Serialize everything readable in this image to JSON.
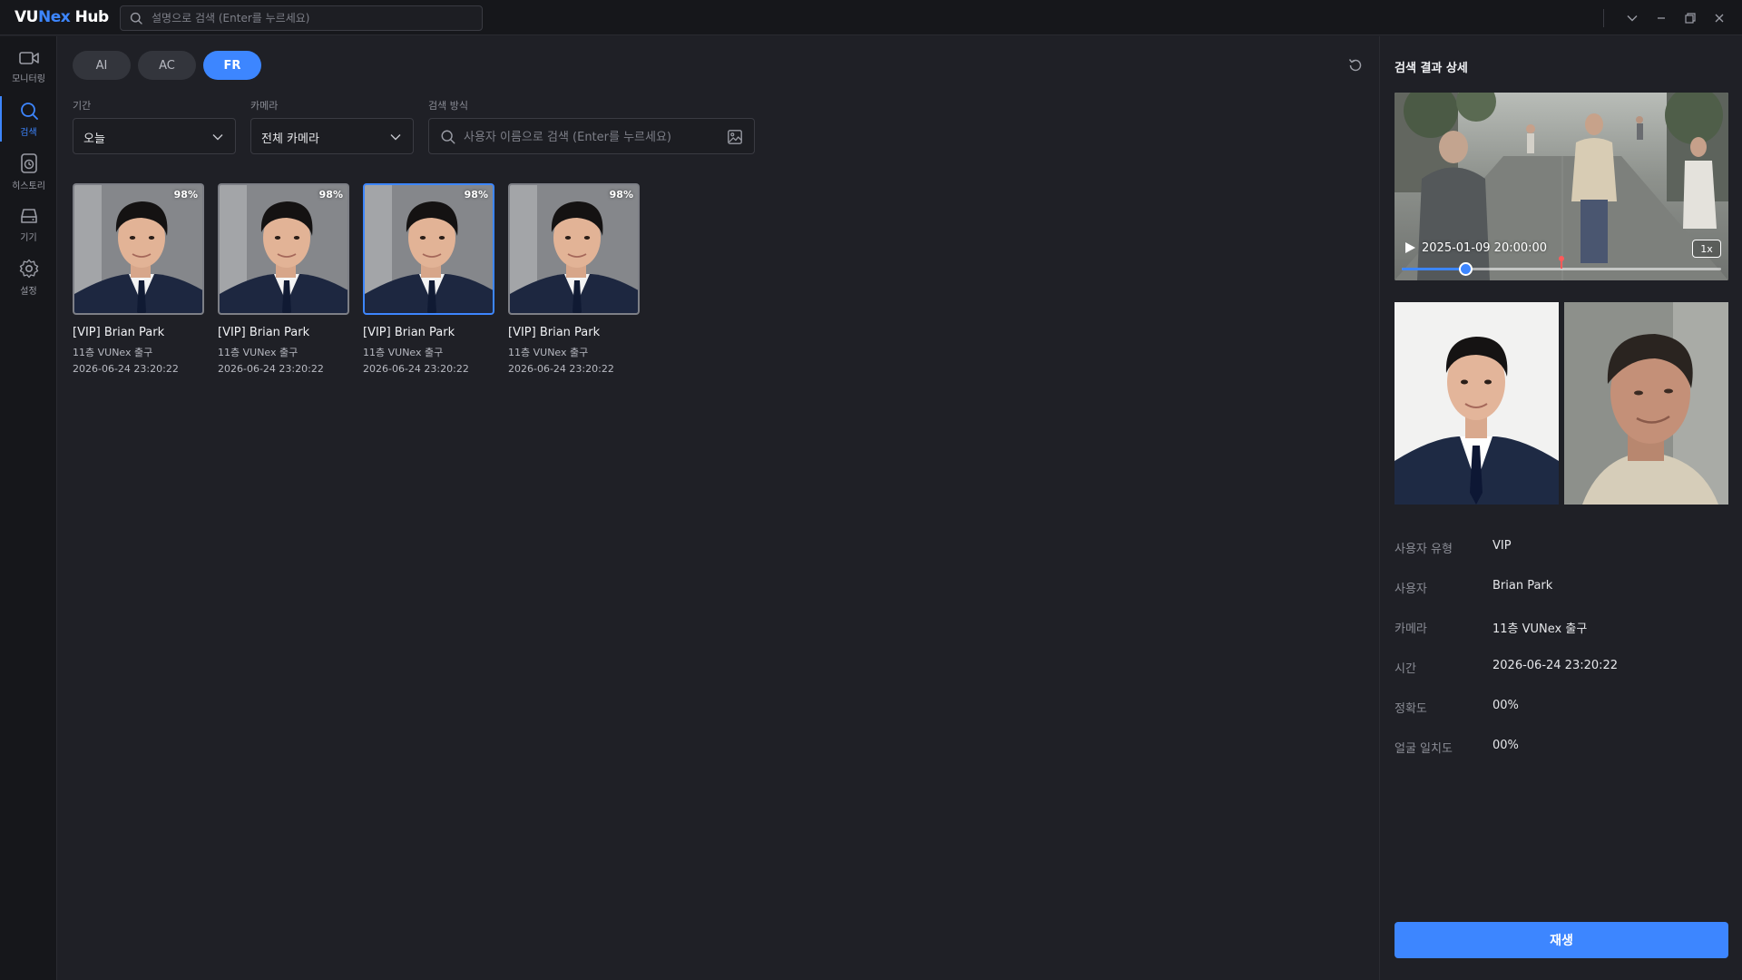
{
  "app": {
    "logo_prefix": "VU",
    "logo_mid": "Nex",
    "logo_suffix": " Hub",
    "search_placeholder": "설명으로 검색 (Enter를 누르세요)"
  },
  "rail": [
    {
      "label": "모니터링",
      "icon": "video-camera-icon"
    },
    {
      "label": "검색",
      "icon": "search-icon"
    },
    {
      "label": "히스토리",
      "icon": "history-icon"
    },
    {
      "label": "기기",
      "icon": "device-icon"
    },
    {
      "label": "설정",
      "icon": "gear-icon"
    }
  ],
  "tabs": [
    "AI",
    "AC",
    "FR"
  ],
  "active_tab": "FR",
  "filters": {
    "period_label": "기간",
    "period_value": "오늘",
    "camera_label": "카메라",
    "camera_value": "전체 카메라",
    "method_label": "검색 방식",
    "method_placeholder": "사용자 이름으로 검색 (Enter를 누르세요)"
  },
  "results": [
    {
      "name": "[VIP] Brian Park",
      "camera": "11층 VUNex 출구",
      "time": "2026-06-24 23:20:22",
      "score": "98%"
    },
    {
      "name": "[VIP] Brian Park",
      "camera": "11층 VUNex 출구",
      "time": "2026-06-24 23:20:22",
      "score": "98%"
    },
    {
      "name": "[VIP] Brian Park",
      "camera": "11층 VUNex 출구",
      "time": "2026-06-24 23:20:22",
      "score": "98%"
    },
    {
      "name": "[VIP] Brian Park",
      "camera": "11층 VUNex 출구",
      "time": "2026-06-24 23:20:22",
      "score": "98%"
    }
  ],
  "selected_result_index": 2,
  "detail": {
    "title": "검색 결과 상세",
    "video_time": "2025-01-09 20:00:00",
    "speed": "1x",
    "progress": 0.2,
    "marker_position": 0.5,
    "rows": [
      {
        "key": "사용자 유형",
        "value": "VIP"
      },
      {
        "key": "사용자",
        "value": "Brian Park"
      },
      {
        "key": "카메라",
        "value": "11층 VUNex 출구"
      },
      {
        "key": "시간",
        "value": "2026-06-24 23:20:22"
      },
      {
        "key": "정확도",
        "value": "00%"
      },
      {
        "key": "얼굴 일치도",
        "value": "00%"
      }
    ],
    "play_label": "재생"
  },
  "colors": {
    "accent": "#3d86ff",
    "background": "#1f2026",
    "rail": "#16171b",
    "marker": "#ff5a5a"
  }
}
